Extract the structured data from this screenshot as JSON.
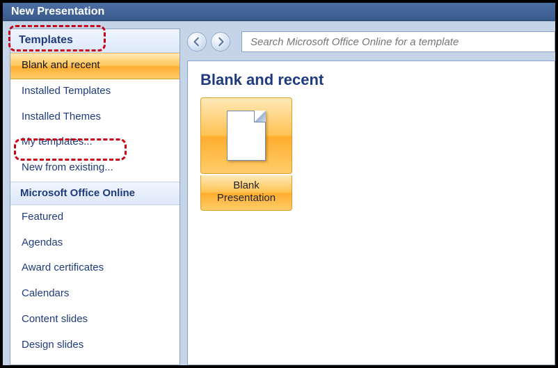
{
  "dialog": {
    "title": "New Presentation"
  },
  "sidebar": {
    "header": "Templates",
    "items": [
      {
        "label": "Blank and recent",
        "selected": true
      },
      {
        "label": "Installed Templates"
      },
      {
        "label": "Installed Themes"
      },
      {
        "label": "My templates..."
      },
      {
        "label": "New from existing..."
      }
    ],
    "online_header": "Microsoft Office Online",
    "online_items": [
      {
        "label": "Featured"
      },
      {
        "label": "Agendas"
      },
      {
        "label": "Award certificates"
      },
      {
        "label": "Calendars"
      },
      {
        "label": "Content slides"
      },
      {
        "label": "Design slides"
      }
    ]
  },
  "search": {
    "placeholder": "Search Microsoft Office Online for a template"
  },
  "content": {
    "title": "Blank and recent",
    "templates": [
      {
        "label": "Blank Presentation"
      }
    ]
  }
}
